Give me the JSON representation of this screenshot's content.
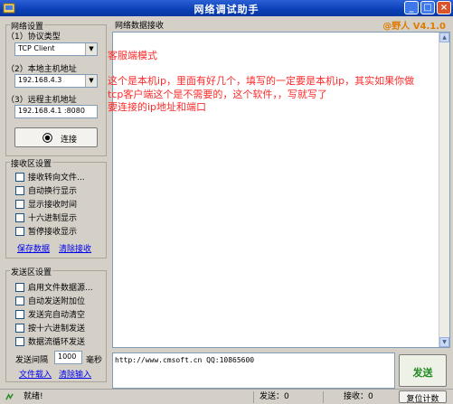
{
  "window": {
    "title": "网络调试助手",
    "min": "_",
    "max": "□",
    "close": "×"
  },
  "net_settings": {
    "legend": "网络设置",
    "protocol_label": "（1）协议类型",
    "protocol_value": "TCP Client",
    "local_ip_label": "（2）本地主机地址",
    "local_ip_value": "192.168.4.3",
    "remote_label": "（3）远程主机地址",
    "remote_value": "192.168.4.1 :8080",
    "connect_label": "连接"
  },
  "recv_settings": {
    "legend": "接收区设置",
    "options": [
      "接收转向文件...",
      "自动换行显示",
      "显示接收时间",
      "十六进制显示",
      "暂停接收显示"
    ],
    "save_link": "保存数据",
    "clear_link": "清除接收"
  },
  "send_settings": {
    "legend": "发送区设置",
    "options": [
      "启用文件数据源...",
      "自动发送附加位",
      "发送完自动清空",
      "按十六进制发送",
      "数据流循环发送"
    ],
    "interval_label": "发送间隔",
    "interval_value": "1000",
    "interval_unit": "毫秒",
    "file_link": "文件载入",
    "clear_link": "清除输入"
  },
  "recv_area": {
    "title": "网络数据接收",
    "brand": "@野人 V4.1.0",
    "notes": [
      "客服端模式",
      "这个是本机ip，里面有好几个，填写的一定要是本机ip，其实如果你做",
      "tcp客户端这个是不需要的，这个软件，，写就写了",
      "要连接的ip地址和端口"
    ]
  },
  "send_area": {
    "text": "http://www.cmsoft.cn QQ:10865600",
    "send_button": "发送"
  },
  "status": {
    "ready": "就绪!",
    "sent": "发送：0",
    "received": "接收：0",
    "reset": "复位计数"
  }
}
